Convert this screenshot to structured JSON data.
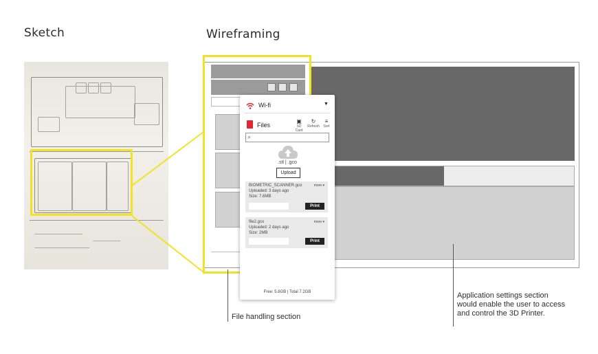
{
  "headings": {
    "sketch": "Sketch",
    "wireframing": "Wireframing"
  },
  "panel": {
    "wifi_label": "Wi-fi",
    "files_label": "Files",
    "toolbar": {
      "sd_card": "SD Card",
      "refresh": "Refresh",
      "sort": "Sort"
    },
    "file_types": ".stl | .gco",
    "upload_button": "Upload",
    "files": [
      {
        "name": "BIOMETRIC_SCANNER.gco",
        "uploaded": "Uploaded: 3 days ago",
        "size": "Size: 7.6MB",
        "more": "more ▾",
        "print": "Print"
      },
      {
        "name": "file2.gco",
        "uploaded": "Uploaded: 2 days ago",
        "size": "Size: 2MB",
        "more": "more ▾",
        "print": "Print"
      }
    ],
    "storage": "Free: 5.6GB | Total 7.2GB"
  },
  "captions": {
    "file_handling": "File handling section",
    "settings": "Application settings section would enable the user to access and control the 3D Printer."
  },
  "colors": {
    "highlight": "#f2e224",
    "wifi_icon": "#e0262f",
    "files_icon": "#e0262f",
    "dark_block": "#686868",
    "cloud": "#c9c9c9"
  }
}
